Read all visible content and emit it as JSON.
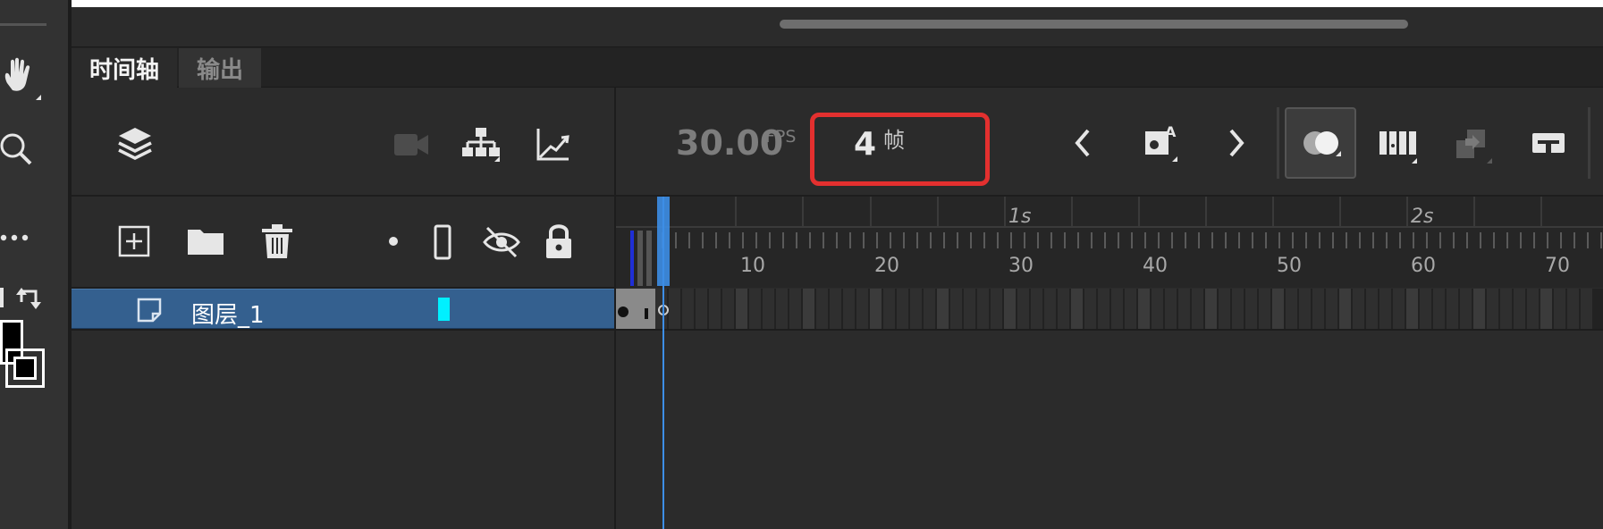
{
  "tabs": {
    "timeline_label": "时间轴",
    "output_label": "输出"
  },
  "header": {
    "fps_value": "30.00",
    "fps_label": "FPS",
    "frame_value": "4",
    "frame_unit": "帧"
  },
  "ruler": {
    "seconds_labels": [
      "1s",
      "2s"
    ],
    "frame_numbers": [
      "10",
      "20",
      "30",
      "40",
      "50",
      "60",
      "70"
    ]
  },
  "layers": [
    {
      "name": "图层_1",
      "color": "#00f0ff",
      "selected": true
    }
  ],
  "icons": {
    "left_tools": [
      "hand-icon",
      "zoom-icon",
      "more-icon",
      "swap-colors-icon",
      "stroke-fill-icon"
    ],
    "layer_header": [
      "layers-icon",
      "camera-icon",
      "parent-hierarchy-icon",
      "graph-icon"
    ],
    "layer_actions": [
      "new-layer-icon",
      "new-folder-icon",
      "delete-icon",
      "highlight-dot-icon",
      "outline-icon",
      "visibility-icon",
      "lock-icon"
    ],
    "timeline_controls": [
      "previous-frame-icon",
      "insert-keyframe-icon",
      "next-frame-icon",
      "onion-skin-icon",
      "edit-multiple-frames-icon",
      "paste-frames-icon",
      "frame-view-icon"
    ]
  },
  "colors": {
    "accent_red": "#e3302f",
    "selection_blue": "#34608f",
    "playhead_blue": "#3d8ee6"
  }
}
